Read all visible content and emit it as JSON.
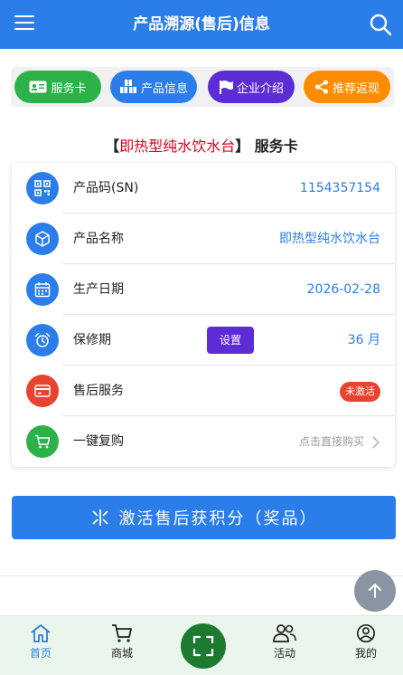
{
  "header": {
    "title": "产品溯源(售后)信息",
    "menu_icon": "menu-icon",
    "search_icon": "search-icon"
  },
  "tabs": [
    {
      "label": "服务卡",
      "color": "#2db24a",
      "icon": "id-card-icon"
    },
    {
      "label": "产品信息",
      "color": "#2b7de9",
      "icon": "boxes-icon"
    },
    {
      "label": "企业介绍",
      "color": "#5c2dd5",
      "icon": "flag-icon"
    },
    {
      "label": "推荐返现",
      "color": "#ff8c00",
      "icon": "share-icon"
    }
  ],
  "card": {
    "bracket_open": "【",
    "product_name": "即热型纯水饮水台",
    "bracket_close": "】",
    "suffix": "服务卡"
  },
  "rows": [
    {
      "label": "产品码(SN)",
      "value": "1154357154",
      "icon": "qrcode-icon",
      "icon_color": "#2b7de9"
    },
    {
      "label": "产品名称",
      "value": "即热型纯水饮水台",
      "icon": "cube-icon",
      "icon_color": "#2b7de9"
    },
    {
      "label": "生产日期",
      "value": "2026-02-28",
      "icon": "calendar-icon",
      "icon_color": "#2b7de9"
    },
    {
      "label": "保修期",
      "value": "36 月",
      "button": "设置",
      "icon": "alarm-clock-icon",
      "icon_color": "#2b7de9"
    },
    {
      "label": "售后服务",
      "badge": "未激活",
      "icon": "card-icon",
      "icon_color": "#e8432f"
    },
    {
      "label": "一键复购",
      "link": "点击直接购买",
      "icon": "cart-icon",
      "icon_color": "#2db24a"
    }
  ],
  "activate_button": "激活售后获积分（奖品）",
  "bottom_nav": [
    {
      "label": "首页",
      "icon": "home-icon",
      "active": true
    },
    {
      "label": "商城",
      "icon": "cart-icon"
    },
    {
      "label": "",
      "icon": "scan-icon"
    },
    {
      "label": "活动",
      "icon": "people-icon"
    },
    {
      "label": "我的",
      "icon": "user-icon"
    }
  ],
  "colors": {
    "primary": "#2b7de9",
    "red": "#d9001b",
    "scan_bg": "#1e7a31",
    "bottom_bg": "#eaf6ec"
  }
}
